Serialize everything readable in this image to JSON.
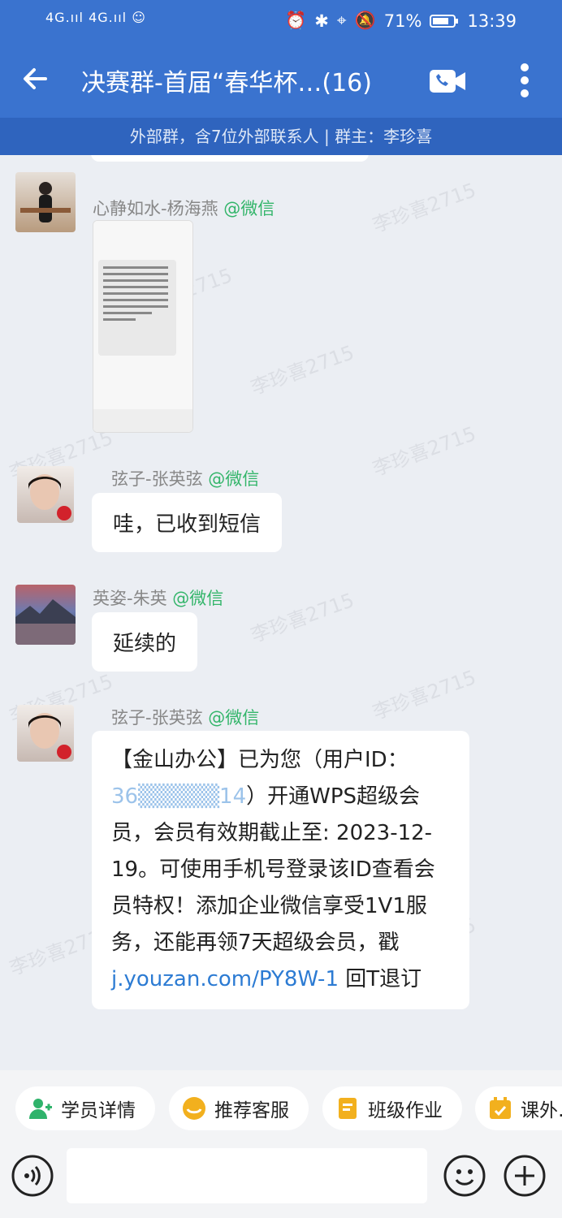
{
  "status_bar": {
    "signal_left": "4G",
    "signal_right": "4G",
    "battery": "71%",
    "time": "13:39"
  },
  "header": {
    "title": "决赛群-首届“春华杯…(16)",
    "subtitle": "外部群，含7位外部联系人 | 群主：李珍喜"
  },
  "watermark": "李珍喜2715",
  "messages": [
    {
      "sender": "心静如水-杨海燕",
      "tag": "@微信",
      "type": "image"
    },
    {
      "sender": "弦子-张英弦",
      "tag": "@微信",
      "text": "哇，已收到短信"
    },
    {
      "sender": "英姿-朱英",
      "tag": "@微信",
      "text": "延续的"
    },
    {
      "sender": "弦子-张英弦",
      "tag": "@微信",
      "text_part1": "【金山办公】已为您（用户ID：",
      "masked_id": "36▒▒▒▒▒14",
      "text_part2": "）开通WPS超级会员，会员有效期截止至: 2023-12-19。可使用手机号登录该ID查看会员特权！添加企业微信享受1V1服务，还能再领7天超级会员，戳",
      "link": "j.youzan.com/PY8W-1",
      "text_part3": " 回T退订"
    }
  ],
  "quick_actions": [
    {
      "label": "学员详情",
      "icon": "student-icon",
      "color": "#2fb36b"
    },
    {
      "label": "推荐客服",
      "icon": "service-icon",
      "color": "#f2b01e"
    },
    {
      "label": "班级作业",
      "icon": "homework-icon",
      "color": "#f2b01e"
    },
    {
      "label": "课外…",
      "icon": "calendar-icon",
      "color": "#f2b01e"
    }
  ],
  "input": {
    "placeholder": ""
  }
}
